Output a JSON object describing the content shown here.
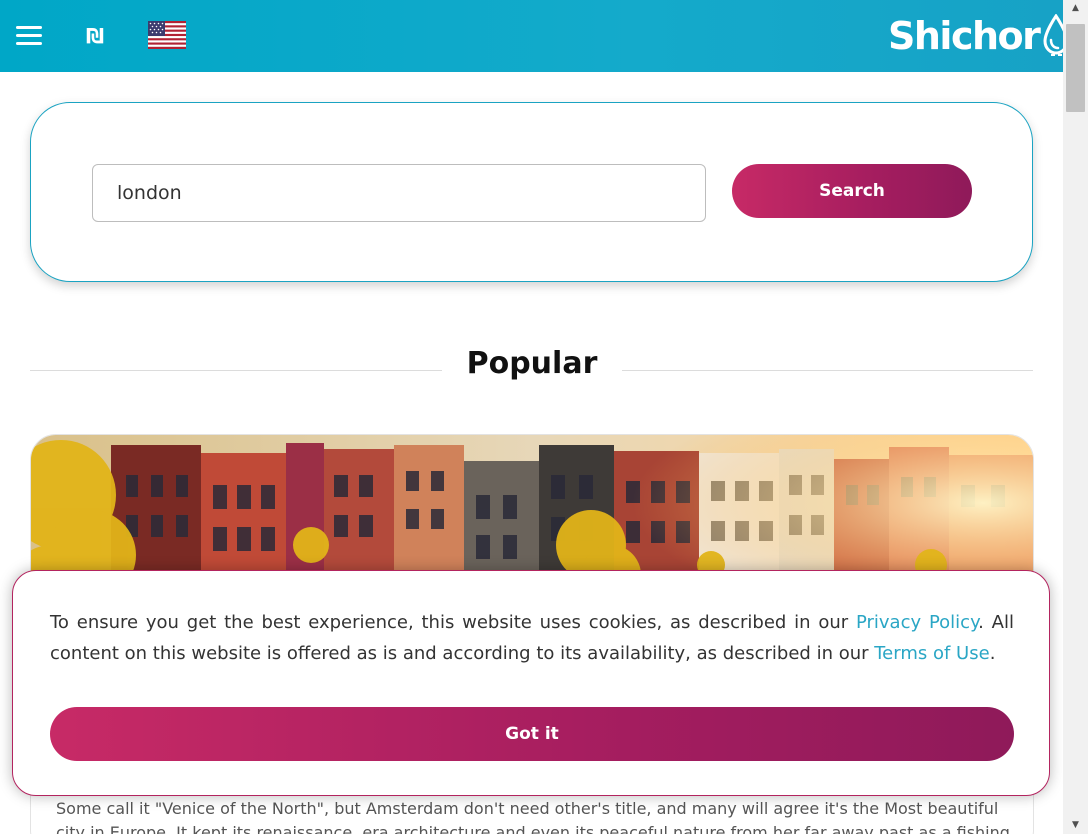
{
  "header": {
    "menu_icon": "hamburger-menu-icon",
    "currency_symbol": "₪",
    "language_flag": "us-flag-icon",
    "logo_text": "Shichor",
    "logo_icon": "water-drop-icon",
    "background": "#00a7c7"
  },
  "search": {
    "input_value": "london",
    "button_label": "Search"
  },
  "popular": {
    "title": "Popular"
  },
  "card": {
    "image": "amsterdam-canal-houses-image",
    "description": "Some call it \"Venice of the North\", but Amsterdam don't need other's title, and many will agree it's the Most beautiful city in Europe. It kept its renaissance, era architecture and even its peaceful nature from her far away past as a fishing village. Th"
  },
  "cookie": {
    "text_before": "To ensure you get the best experience, this website uses cookies, as described in our ",
    "privacy_link": "Privacy Policy",
    "text_middle": ". All content on this website is offered as is and according to its availability, as described in our ",
    "terms_link": "Terms of Use",
    "text_after": ".",
    "button_label": "Got it",
    "accent": "#b3245f",
    "link_color": "#2aa6c5"
  },
  "scrollbar": {
    "up_icon": "scroll-up-arrow-icon",
    "down_icon": "scroll-down-arrow-icon"
  }
}
